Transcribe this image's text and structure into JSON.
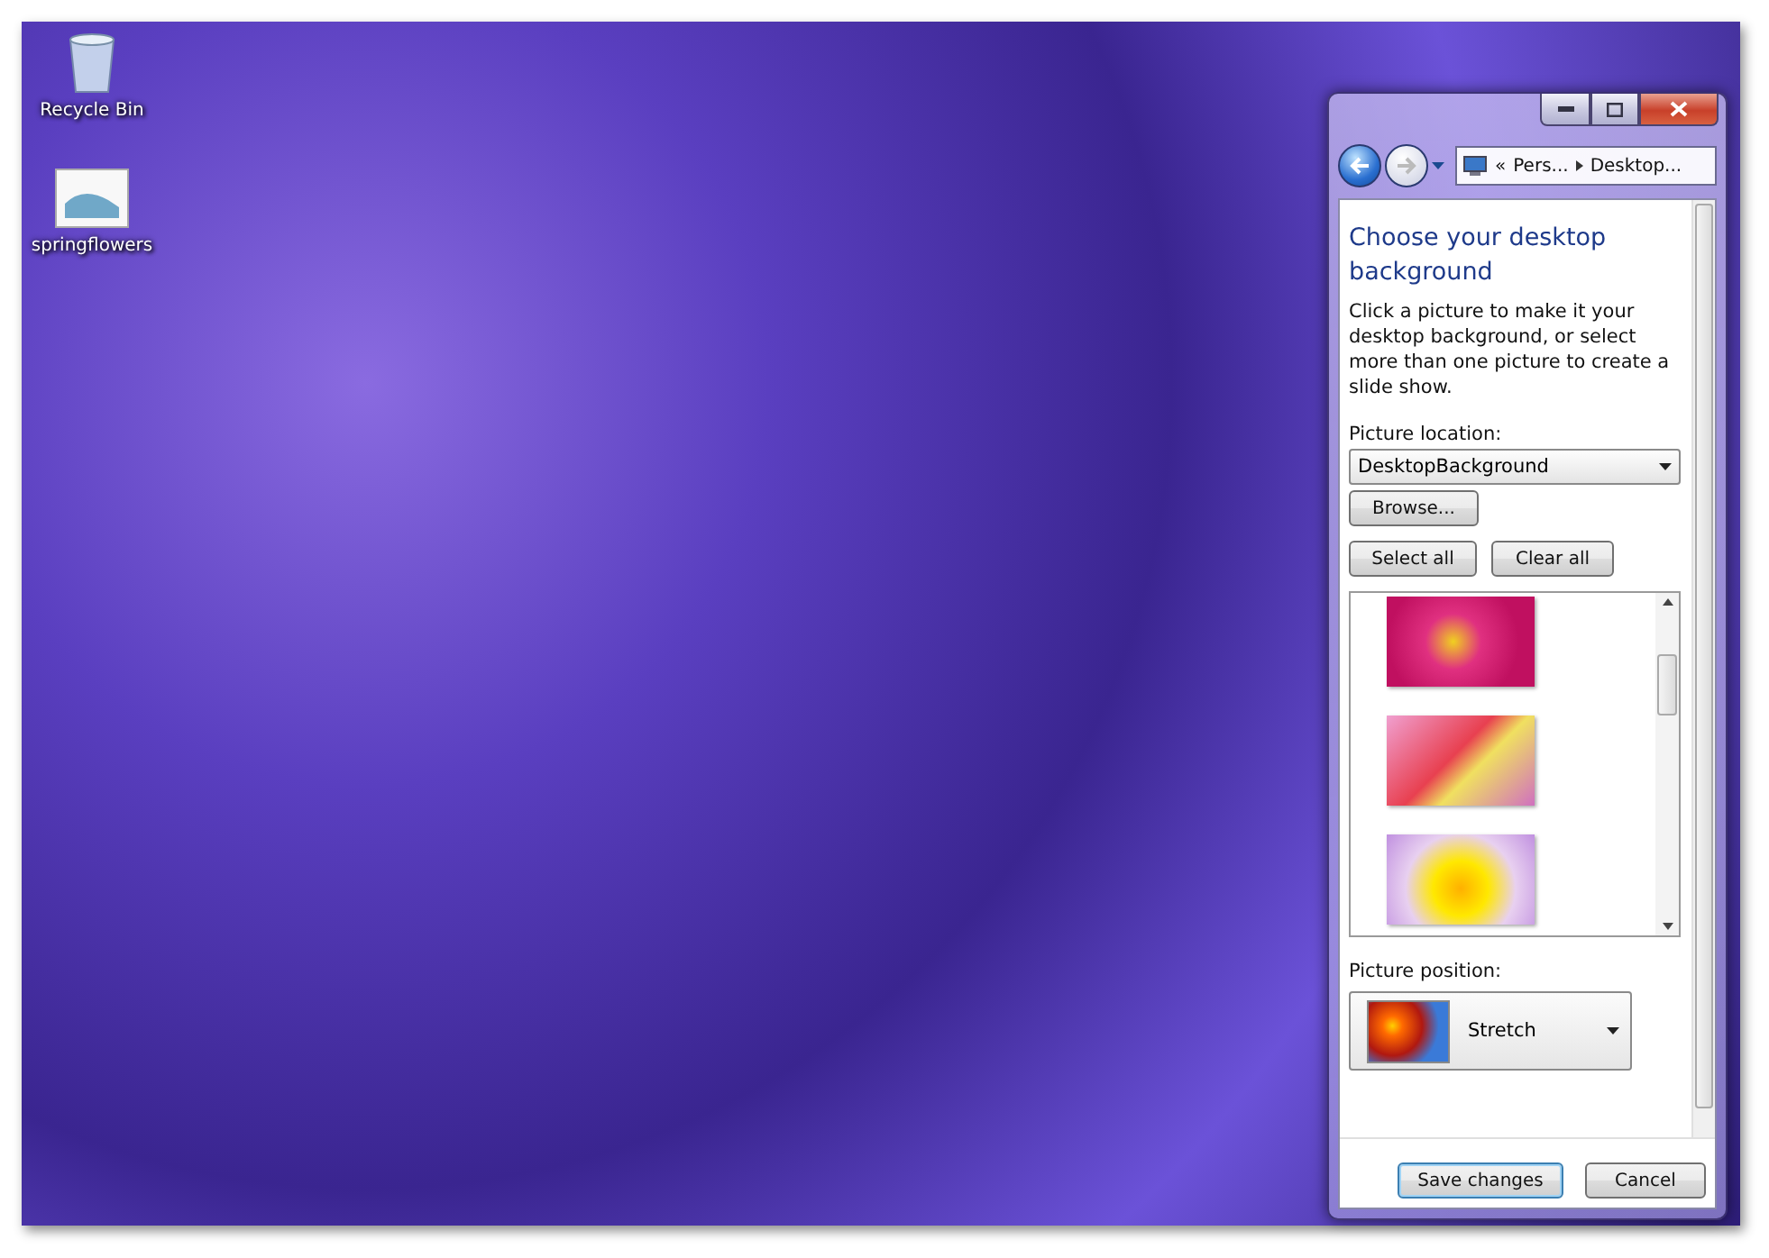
{
  "desktop": {
    "icons": [
      {
        "label": "Recycle Bin",
        "kind": "bin"
      },
      {
        "label": "springflowers",
        "kind": "file"
      }
    ]
  },
  "window": {
    "address": {
      "overflow": "«",
      "crumbs": [
        "Pers...",
        "Desktop..."
      ]
    },
    "heading": "Choose your desktop background",
    "description": "Click a picture to make it your desktop background, or select more than one picture to create a slide show.",
    "location_label": "Picture location:",
    "location_value": "DesktopBackground",
    "browse": "Browse...",
    "select_all": "Select all",
    "clear_all": "Clear all",
    "position_label": "Picture position:",
    "position_value": "Stretch",
    "buttons": [
      {
        "label": "Save changes",
        "default": true
      },
      {
        "label": "Cancel",
        "default": false
      }
    ]
  }
}
